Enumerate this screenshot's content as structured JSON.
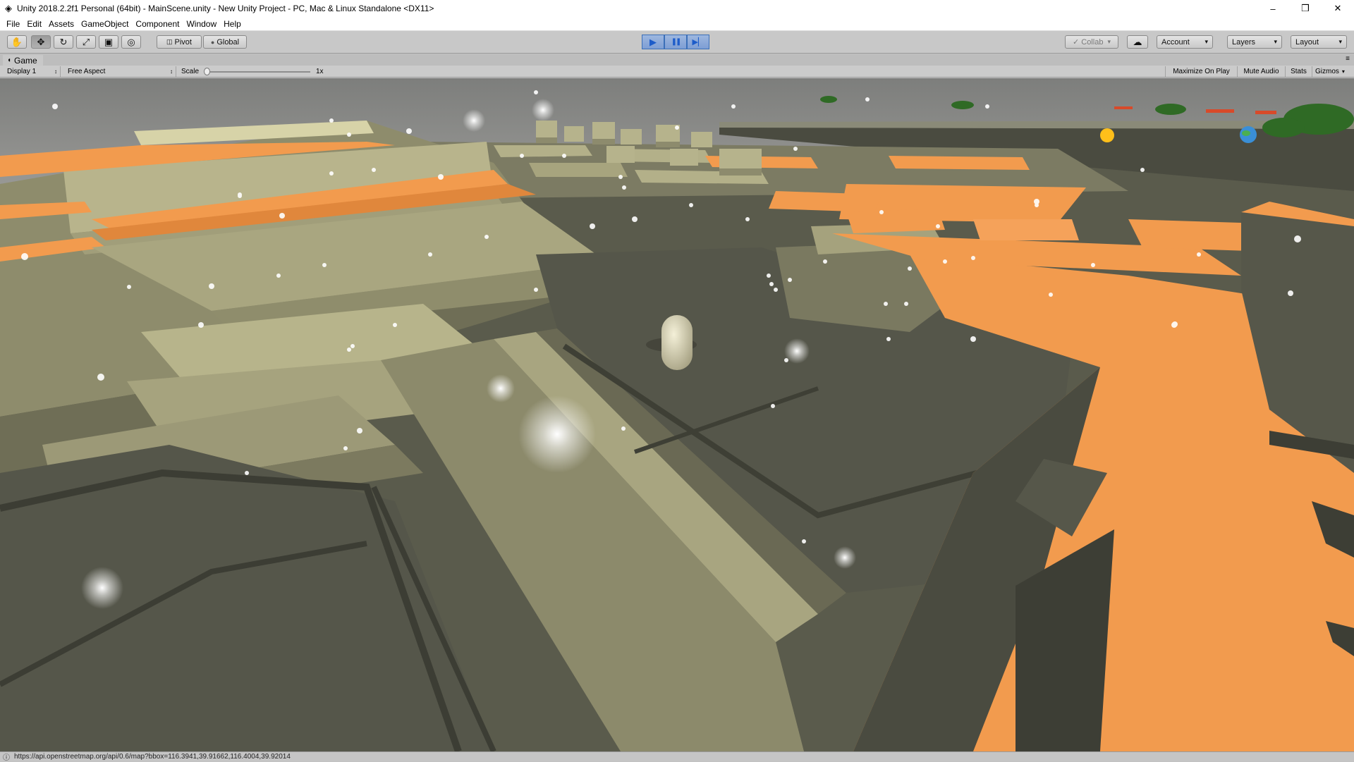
{
  "window": {
    "title": "Unity 2018.2.2f1 Personal (64bit) - MainScene.unity - New Unity Project - PC, Mac & Linux Standalone <DX11>",
    "app_icon": "unity-logo-icon",
    "minimize": "–",
    "maximize": "❒",
    "close": "✕"
  },
  "menu": [
    "File",
    "Edit",
    "Assets",
    "GameObject",
    "Component",
    "Window",
    "Help"
  ],
  "toolbar": {
    "tools": [
      {
        "name": "hand-tool-icon",
        "glyph": "✋"
      },
      {
        "name": "move-tool-icon",
        "glyph": "✥"
      },
      {
        "name": "rotate-tool-icon",
        "glyph": "↻"
      },
      {
        "name": "scale-tool-icon",
        "glyph": "⤢"
      },
      {
        "name": "rect-tool-icon",
        "glyph": "▣"
      },
      {
        "name": "transform-tool-icon",
        "glyph": "◎"
      }
    ],
    "pivot_label": "Pivot",
    "pivot_glyph": "◫",
    "global_label": "Global",
    "global_glyph": "●",
    "play_glyph": "▶",
    "pause_glyph": "❚❚",
    "step_glyph": "▶▏",
    "collab_label": "Collab",
    "collab_glyph": "✓",
    "cloud_glyph": "☁",
    "account_label": "Account",
    "layers_label": "Layers",
    "layout_label": "Layout",
    "dropdown_glyph": "▾"
  },
  "game_tab": {
    "label": "Game",
    "icon": "gamepad-icon",
    "icon_glyph": "◖",
    "menu_glyph": "≡"
  },
  "game_toolbar": {
    "display": "Display 1",
    "aspect": "Free Aspect",
    "scale_label": "Scale",
    "scale_value": "1x",
    "scale_fraction": 0.0,
    "maximize_on_play": "Maximize On Play",
    "mute_audio": "Mute Audio",
    "stats": "Stats",
    "gizmos": "Gizmos",
    "updown_glyph": "↕"
  },
  "status": {
    "icon_glyph": "ⓘ",
    "text": "https://api.openstreetmap.org/api/0.6/map?bbox=116.3941,39.91662,116.4004,39.92014"
  },
  "colors": {
    "orange_top": "#f29b4e",
    "olive_top": "#a3a17a",
    "ground": "#5b5c4d",
    "sky": "#8c8c8a"
  }
}
